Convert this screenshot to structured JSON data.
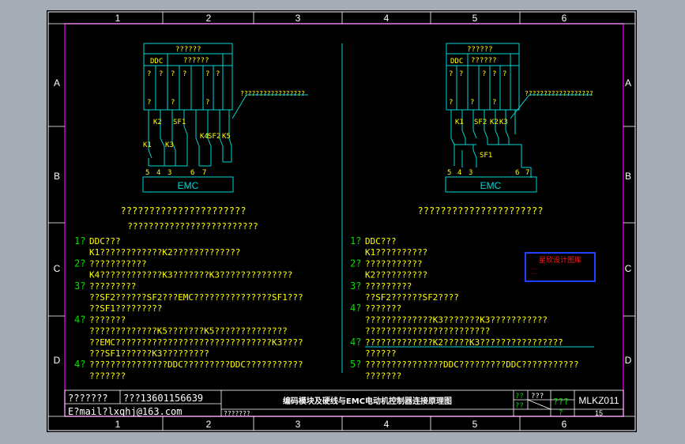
{
  "frame": {
    "columns": [
      "1",
      "2",
      "3",
      "4",
      "5",
      "6"
    ],
    "rows": [
      "A",
      "B",
      "C",
      "D"
    ]
  },
  "left": {
    "header": "??????",
    "ddc": "DDC",
    "box_label": "??????",
    "cells": [
      "?",
      "?",
      "?",
      "?",
      "?",
      "?",
      "?",
      "?",
      "?"
    ],
    "callout": "?????????????????",
    "labels": {
      "k1": "K1",
      "k2": "K2",
      "sf1": "SF1",
      "k3": "K3",
      "k4": "K4",
      "sf2": "SF2",
      "k5": "K5"
    },
    "terms": [
      "5",
      "4",
      "3",
      "6",
      "7"
    ],
    "emc": "EMC",
    "title1": "??????????????????????",
    "title2": "?????????????????????????",
    "notes": [
      {
        "num": "1?",
        "text": "DDC???"
      },
      {
        "num": "",
        "text": "K1????????????K2?????????????"
      },
      {
        "num": "2?",
        "text": "???????????"
      },
      {
        "num": "",
        "text": "K4????????????K3???????K3??????????????"
      },
      {
        "num": "3?",
        "text": "?????????"
      },
      {
        "num": "",
        "text": "??SF2??????SF2???EMC???????????????SF1???"
      },
      {
        "num": "",
        "text": "??SF1?????????"
      },
      {
        "num": "4?",
        "text": "???????"
      },
      {
        "num": "",
        "text": "?????????????K5???????K5??????????????"
      },
      {
        "num": "",
        "text": "??EMC??????????????????????????????K3????"
      },
      {
        "num": "",
        "text": "???SF1??????K3?????????"
      },
      {
        "num": "4?",
        "text": "???????????????DDC?????????DDC???????????"
      },
      {
        "num": "",
        "text": "???????"
      }
    ]
  },
  "right": {
    "header": "??????",
    "ddc": "DDC",
    "box_label": "??????",
    "callout": "??????????????????",
    "labels": {
      "k1": "K1",
      "sf2": "SF2",
      "k2": "K2",
      "k3": "K3",
      "sf1": "SF1"
    },
    "terms": [
      "5",
      "4",
      "3",
      "6",
      "7"
    ],
    "emc": "EMC",
    "title1": "??????????????????????",
    "notes": [
      {
        "num": "1?",
        "text": "DDC???"
      },
      {
        "num": "",
        "text": "K1??????????"
      },
      {
        "num": "2?",
        "text": "???????????"
      },
      {
        "num": "",
        "text": "K2??????????"
      },
      {
        "num": "3?",
        "text": "?????????"
      },
      {
        "num": "",
        "text": "??SF2??????SF2????"
      },
      {
        "num": "4?",
        "text": "???????"
      },
      {
        "num": "",
        "text": "?????????????K3???????K3???????????"
      },
      {
        "num": "",
        "text": "????????????????????????"
      },
      {
        "num": "4?",
        "text": "?????????????K2?????K3????????????????"
      },
      {
        "num": "",
        "text": "??????"
      },
      {
        "num": "5?",
        "text": "???????????????DDC?????????DDC???????????"
      },
      {
        "num": "",
        "text": "???????"
      }
    ]
  },
  "stamp": {
    "title": "星欣设计图库",
    "line1": "……",
    "line2": "……",
    "footer": "……"
  },
  "title_block": {
    "label1": "???????",
    "phone": "???13601156639",
    "email": "E?mail?lxqhj@163.com",
    "label2": "???????",
    "drawing_title": "编码模块及硬线与EMC电动机控制器连接原理图",
    "f1": "??",
    "f2": "??",
    "f3": "???",
    "f4": "???",
    "f5": "?",
    "code": "MLKZ011",
    "sheet": "15"
  },
  "colors": {
    "background": "#000000",
    "surround": "#a5acb5",
    "frame": "#ffffff",
    "magenta": "#cc00cc",
    "cyan": "#00d6d6",
    "yellow": "#ffff00",
    "green": "#00e000",
    "stamp_red": "#ff2020",
    "stamp_blue": "#2040ff"
  }
}
